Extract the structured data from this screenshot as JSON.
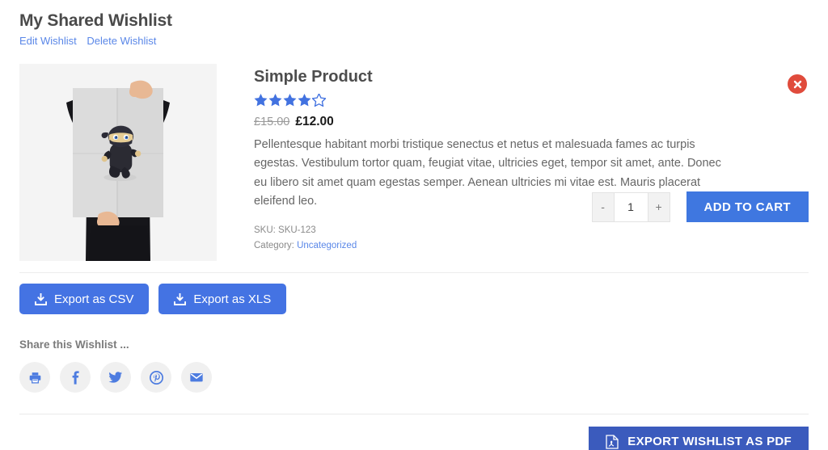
{
  "wishlist": {
    "title": "My Shared Wishlist",
    "edit_label": "Edit Wishlist",
    "delete_label": "Delete Wishlist"
  },
  "product": {
    "name": "Simple Product",
    "rating": 4,
    "rating_max": 5,
    "price_old": "£15.00",
    "price_new": "£12.00",
    "description": "Pellentesque habitant morbi tristique senectus et netus et malesuada fames ac turpis egestas. Vestibulum tortor quam, feugiat vitae, ultricies eget, tempor sit amet, ante. Donec eu libero sit amet quam egestas semper. Aenean ultricies mi vitae est. Mauris placerat eleifend leo.",
    "sku_label": "SKU: SKU-123",
    "category_label": "Category:",
    "category_value": "Uncategorized",
    "quantity": "1",
    "qty_minus": "-",
    "qty_plus": "+",
    "add_to_cart_label": "ADD TO CART",
    "image_alt": "person-holding-ninja-poster"
  },
  "exports": {
    "csv_label": "Export as CSV",
    "xls_label": "Export as XLS"
  },
  "share": {
    "label": "Share this Wishlist ...",
    "items": [
      {
        "name": "print",
        "title": "Print"
      },
      {
        "name": "facebook",
        "title": "Facebook"
      },
      {
        "name": "twitter",
        "title": "Twitter"
      },
      {
        "name": "pinterest",
        "title": "Pinterest"
      },
      {
        "name": "email",
        "title": "Email"
      }
    ]
  },
  "footer": {
    "pdf_label": "EXPORT WISHLIST AS PDF"
  },
  "colors": {
    "accent_blue": "#3f77e0",
    "export_blue": "#4473e3",
    "pdf_blue": "#3b5bbd",
    "link_blue": "#5a87e8",
    "star_blue": "#4272e0",
    "remove_red": "#e04b3c",
    "share_circle": "#f0f0f0"
  }
}
